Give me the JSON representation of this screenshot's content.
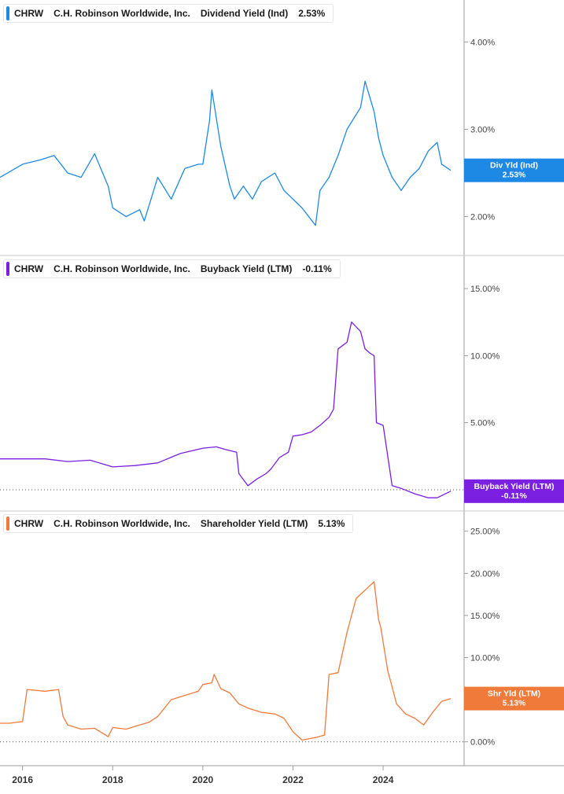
{
  "ticker": "CHRW",
  "company": "C.H. Robinson Worldwide, Inc.",
  "x_axis_labels": [
    "2016",
    "2018",
    "2020",
    "2022",
    "2024"
  ],
  "chart_data": [
    {
      "type": "line",
      "metric": "Dividend Yield (Ind)",
      "current_value": "2.53%",
      "badge": {
        "label": "Div Yld (Ind)",
        "value": "2.53%"
      },
      "color": "#1e88e5",
      "yticks": [
        "4.00%",
        "3.00%",
        "2.00%"
      ],
      "ytick_values": [
        4,
        3,
        2
      ],
      "ylim": [
        1.6,
        4.3
      ],
      "zero_line": false,
      "x": [
        2015.5,
        2016.0,
        2016.4,
        2016.7,
        2017.0,
        2017.3,
        2017.6,
        2017.9,
        2018.0,
        2018.3,
        2018.6,
        2018.7,
        2019.0,
        2019.3,
        2019.6,
        2019.9,
        2020.0,
        2020.15,
        2020.2,
        2020.4,
        2020.6,
        2020.7,
        2020.9,
        2021.1,
        2021.3,
        2021.6,
        2021.8,
        2022.0,
        2022.2,
        2022.5,
        2022.6,
        2022.8,
        2023.0,
        2023.2,
        2023.5,
        2023.6,
        2023.8,
        2023.9,
        2024.0,
        2024.2,
        2024.4,
        2024.6,
        2024.8,
        2025.0,
        2025.2,
        2025.3,
        2025.5
      ],
      "y": [
        2.45,
        2.6,
        2.65,
        2.7,
        2.5,
        2.45,
        2.72,
        2.35,
        2.1,
        2.0,
        2.08,
        1.95,
        2.45,
        2.2,
        2.55,
        2.6,
        2.6,
        3.1,
        3.45,
        2.8,
        2.35,
        2.2,
        2.35,
        2.2,
        2.4,
        2.5,
        2.3,
        2.2,
        2.1,
        1.9,
        2.3,
        2.45,
        2.7,
        3.0,
        3.25,
        3.55,
        3.2,
        2.9,
        2.7,
        2.45,
        2.3,
        2.45,
        2.55,
        2.75,
        2.85,
        2.6,
        2.53
      ]
    },
    {
      "type": "line",
      "metric": "Buyback Yield (LTM)",
      "current_value": "-0.11%",
      "badge": {
        "label": "Buyback Yield (LTM)",
        "value": "-0.11%"
      },
      "color": "#7b1fe0",
      "yticks": [
        "15.00%",
        "10.00%",
        "5.00%"
      ],
      "ytick_values": [
        15,
        10,
        5
      ],
      "ylim": [
        -1,
        16
      ],
      "zero_line": true,
      "x": [
        2015.5,
        2016.0,
        2016.5,
        2017.0,
        2017.5,
        2018.0,
        2018.5,
        2019.0,
        2019.5,
        2020.0,
        2020.3,
        2020.5,
        2020.75,
        2020.8,
        2021.0,
        2021.2,
        2021.4,
        2021.5,
        2021.7,
        2021.9,
        2022.0,
        2022.2,
        2022.4,
        2022.6,
        2022.8,
        2022.9,
        2023.0,
        2023.2,
        2023.3,
        2023.5,
        2023.6,
        2023.7,
        2023.8,
        2023.85,
        2024.0,
        2024.2,
        2024.4,
        2024.7,
        2025.0,
        2025.2,
        2025.5
      ],
      "y": [
        2.3,
        2.3,
        2.3,
        2.1,
        2.2,
        1.7,
        1.8,
        2.0,
        2.7,
        3.1,
        3.2,
        3.0,
        2.8,
        1.2,
        0.3,
        0.8,
        1.2,
        1.5,
        2.4,
        2.8,
        4.0,
        4.1,
        4.3,
        4.8,
        5.4,
        6.0,
        10.5,
        11.0,
        12.5,
        11.8,
        10.5,
        10.2,
        10.0,
        5.0,
        4.8,
        0.3,
        0.1,
        -0.3,
        -0.6,
        -0.6,
        -0.11
      ]
    },
    {
      "type": "line",
      "metric": "Shareholder Yield (LTM)",
      "current_value": "5.13%",
      "badge": {
        "label": "Shr Yld (LTM)",
        "value": "5.13%"
      },
      "color": "#f07a3a",
      "yticks": [
        "25.00%",
        "20.00%",
        "15.00%",
        "10.00%",
        "5.00%",
        "0.00%"
      ],
      "ytick_values": [
        25,
        20,
        15,
        10,
        5,
        0
      ],
      "ylim": [
        -2,
        26
      ],
      "zero_line": true,
      "x": [
        2015.5,
        2015.7,
        2016.0,
        2016.1,
        2016.5,
        2016.8,
        2016.9,
        2017.0,
        2017.3,
        2017.6,
        2017.9,
        2018.0,
        2018.3,
        2018.6,
        2018.8,
        2019.0,
        2019.3,
        2019.6,
        2019.9,
        2020.0,
        2020.2,
        2020.25,
        2020.4,
        2020.6,
        2020.8,
        2021.0,
        2021.3,
        2021.6,
        2021.8,
        2022.0,
        2022.2,
        2022.5,
        2022.7,
        2022.8,
        2023.0,
        2023.2,
        2023.4,
        2023.6,
        2023.8,
        2023.9,
        2023.95,
        2024.1,
        2024.3,
        2024.5,
        2024.7,
        2024.9,
        2025.1,
        2025.3,
        2025.5
      ],
      "y": [
        2.2,
        2.2,
        2.4,
        6.2,
        6.0,
        6.2,
        3.0,
        2.0,
        1.5,
        1.6,
        0.6,
        1.7,
        1.5,
        2.0,
        2.3,
        3.0,
        5.0,
        5.5,
        6.0,
        6.8,
        7.0,
        8.0,
        6.3,
        5.8,
        4.5,
        4.0,
        3.5,
        3.3,
        2.8,
        1.2,
        0.2,
        0.5,
        0.8,
        8.0,
        8.2,
        13.0,
        17.0,
        18.0,
        19.0,
        14.5,
        13.5,
        8.5,
        4.5,
        3.3,
        2.8,
        2.0,
        3.5,
        4.8,
        5.13
      ]
    }
  ]
}
